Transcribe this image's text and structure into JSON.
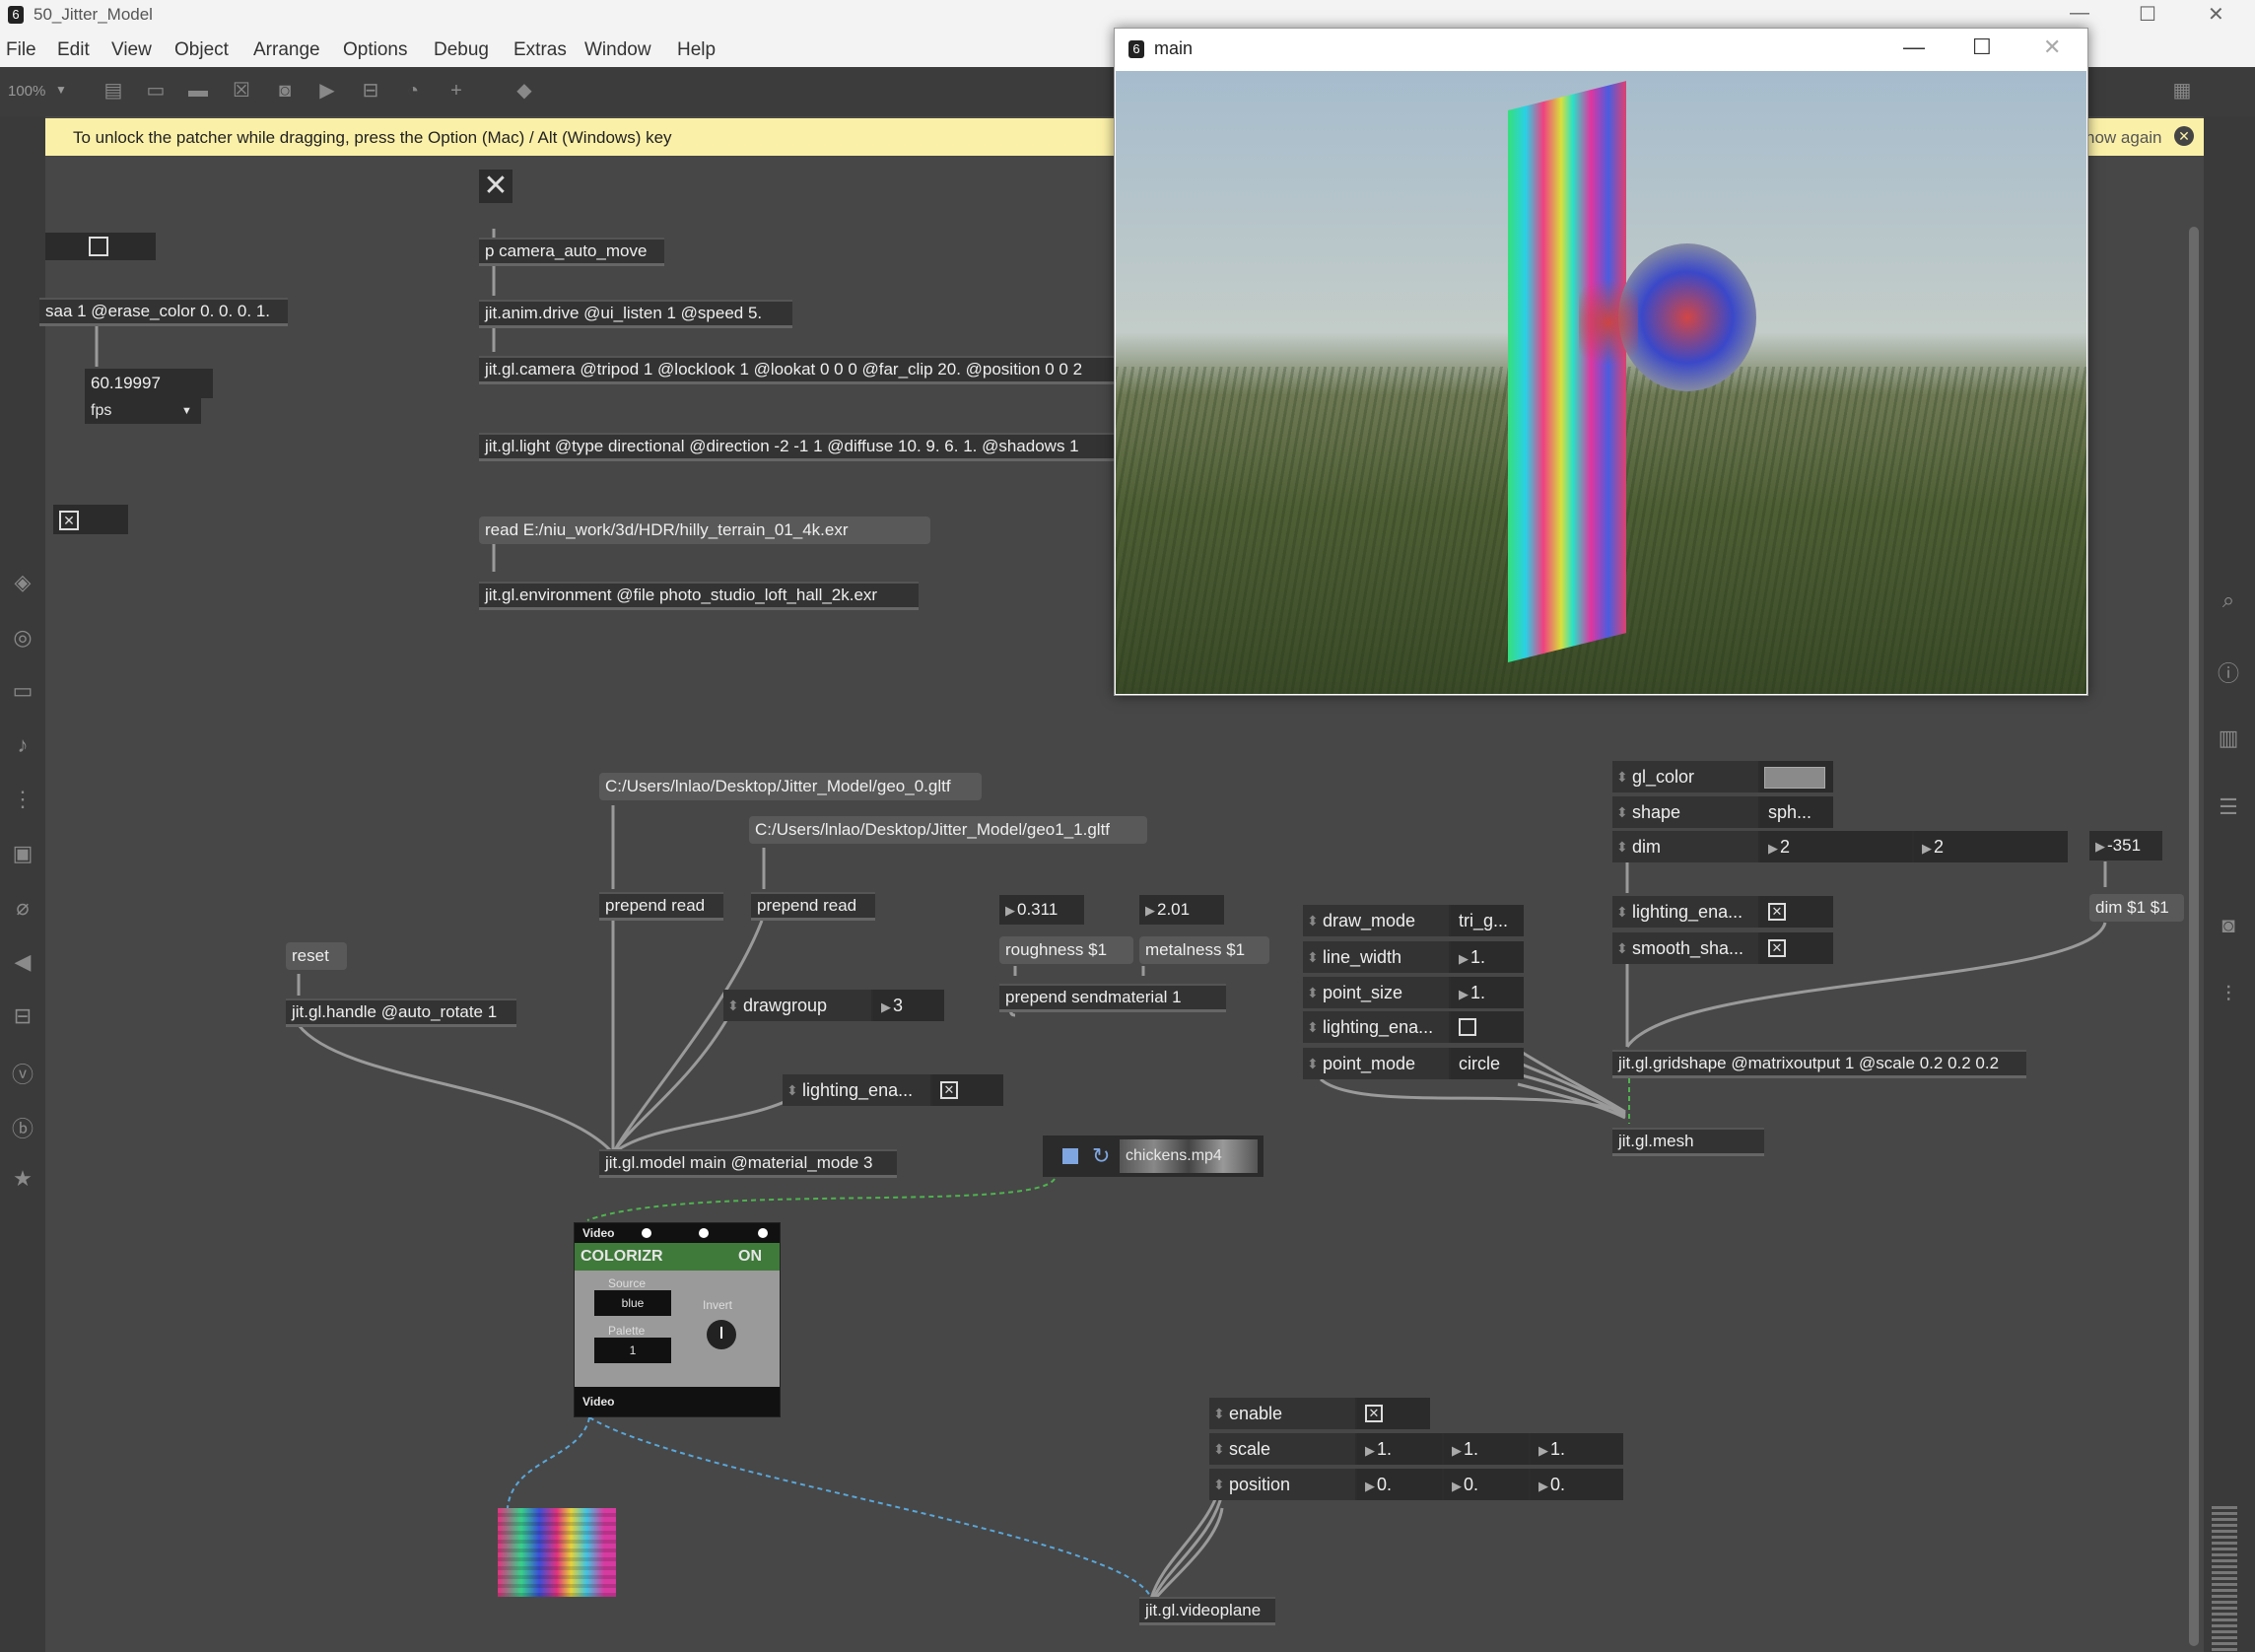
{
  "window": {
    "title": "50_Jitter_Model",
    "controls": [
      "—",
      "☐",
      "✕"
    ]
  },
  "menu": [
    "File",
    "Edit",
    "View",
    "Object",
    "Arrange",
    "Options",
    "Debug",
    "Extras",
    "Window",
    "Help"
  ],
  "toolbar": {
    "zoom": "100%"
  },
  "infobar": {
    "message": "To unlock the patcher while dragging, press the Option (Mac) / Alt (Windows) key",
    "dismiss": "how again"
  },
  "mainwin": {
    "title": "main",
    "controls": [
      "—",
      "☐",
      "✕"
    ]
  },
  "patch": {
    "fps_value": "60.19997",
    "fps_unit": "fps",
    "erase_obj": "saa 1 @erase_color 0. 0. 0. 1.",
    "cam_auto": "p camera_auto_move",
    "anim": "jit.anim.drive @ui_listen 1 @speed 5.",
    "camera": "jit.gl.camera @tripod 1 @locklook 1 @lookat 0 0 0 @far_clip 20. @position 0 0 2",
    "light": "jit.gl.light @type directional @direction -2 -1 1 @diffuse 10. 9. 6. 1. @shadows 1",
    "read_msg": "read E:/niu_work/3d/HDR/hilly_terrain_01_4k.exr",
    "env": "jit.gl.environment @file photo_studio_loft_hall_2k.exr",
    "path0": "C:/Users/lnlao/Desktop/Jitter_Model/geo_0.gltf",
    "path1": "C:/Users/lnlao/Desktop/Jitter_Model/geo1_1.gltf",
    "prepend_read": "prepend read",
    "reset": "reset",
    "handle": "jit.gl.handle @auto_rotate 1",
    "drawgroup": "drawgroup",
    "drawgroup_val": "3",
    "rough_val": "0.311",
    "metal_val": "2.01",
    "roughness": "roughness $1",
    "metalness": "metalness $1",
    "sendmat": "prepend sendmaterial 1",
    "lighting_ena": "lighting_ena...",
    "model": "jit.gl.model main @material_mode 3",
    "movie": "chickens.mp4",
    "draw_mode": "draw_mode",
    "draw_mode_val": "tri_g...",
    "line_width": "line_width",
    "line_width_val": "1.",
    "point_size": "point_size",
    "point_size_val": "1.",
    "point_mode": "point_mode",
    "point_mode_val": "circle",
    "gl_color": "gl_color",
    "shape": "shape",
    "shape_val": "sph...",
    "dim": "dim",
    "dim_v1": "2",
    "dim_v2": "2",
    "neg": "-351",
    "dimmsg": "dim $1 $1",
    "smooth_sha": "smooth_sha...",
    "gridshape": "jit.gl.gridshape @matrixoutput 1 @scale 0.2 0.2 0.2",
    "mesh": "jit.gl.mesh",
    "enable": "enable",
    "scale": "scale",
    "position": "position",
    "scale_vals": [
      "1.",
      "1.",
      "1."
    ],
    "pos_vals": [
      "0.",
      "0.",
      "0."
    ],
    "videoplane": "jit.gl.videoplane"
  },
  "colorizr": {
    "header": "Video",
    "title": "COLORIZR",
    "state": "ON",
    "source_label": "Source",
    "source_val": "blue",
    "palette_label": "Palette",
    "palette_val": "1",
    "invert_label": "Invert",
    "footer": "Video"
  },
  "colors": {
    "accent": "#3f7a3a",
    "background": "#474747",
    "infobar": "#fbf0a8"
  }
}
